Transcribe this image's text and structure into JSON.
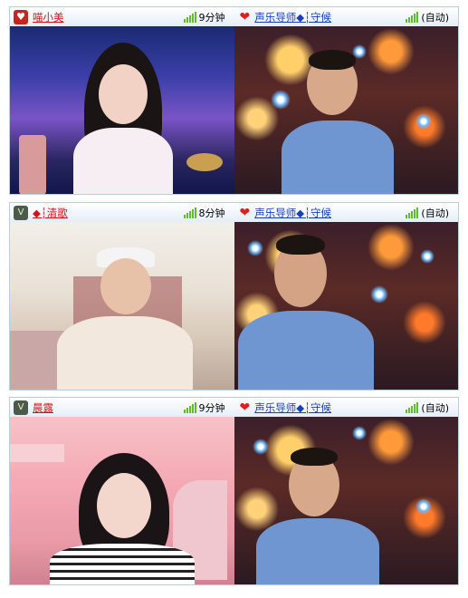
{
  "rows": [
    {
      "left": {
        "user": "喵小美",
        "badge": "heart-icon",
        "duration": "9分钟"
      },
      "right": {
        "user": "声乐导师◆┆守候",
        "status": "(自动)"
      }
    },
    {
      "left": {
        "user": "◆┆清歌",
        "badge": "wings-icon",
        "duration": "8分钟"
      },
      "right": {
        "user": "声乐导师◆┆守候",
        "status": "(自动)"
      }
    },
    {
      "left": {
        "user": "晨露",
        "badge": "wings-icon",
        "duration": "9分钟"
      },
      "right": {
        "user": "声乐导师◆┆守候",
        "status": "(自动)"
      }
    }
  ],
  "colors": {
    "username_left": "#d2141a",
    "username_right": "#1a3fb5",
    "signal": "#5cbf2a",
    "header_border": "#b9cfe0"
  }
}
